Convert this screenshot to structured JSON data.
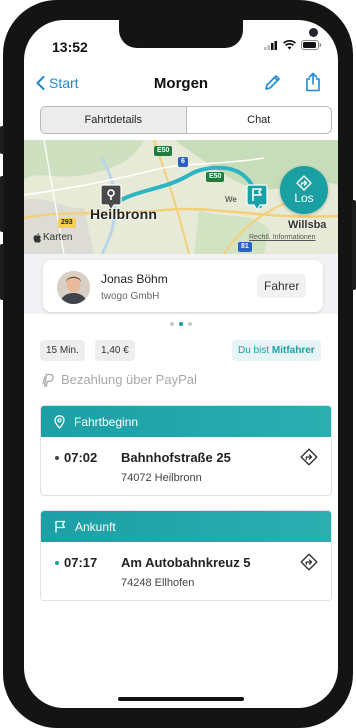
{
  "status_bar": {
    "time": "13:52"
  },
  "nav": {
    "back_label": "Start",
    "title": "Morgen"
  },
  "segments": {
    "details": "Fahrtdetails",
    "chat": "Chat"
  },
  "map": {
    "city": "Heilbronn",
    "town": "Willsba",
    "village": "We",
    "brand": "Karten",
    "legal": "Rechtl. Informationen",
    "shields": [
      "E50",
      "6",
      "E50",
      "293",
      "81"
    ],
    "go_button_label": "Los"
  },
  "driver": {
    "name": "Jonas Böhm",
    "company": "twogo GmbH",
    "role": "Fahrer"
  },
  "pager": {
    "count": 3,
    "active": 1
  },
  "chips": {
    "duration": "15 Min.",
    "price": "1,40 €",
    "role_prefix": "Du bist",
    "role_value": "Mitfahrer"
  },
  "payment": {
    "label": "Bezahlung über PayPal"
  },
  "start": {
    "heading": "Fahrtbeginn",
    "time": "07:02",
    "street": "Bahnhofstraße 25",
    "city": "74072 Heilbronn"
  },
  "arrival": {
    "heading": "Ankunft",
    "time": "07:17",
    "street": "Am Autobahnkreuz 5",
    "city": "74248 Ellhofen"
  },
  "colors": {
    "accent": "#1a9fa2",
    "link": "#1f89cf",
    "route": "#26a3b5"
  },
  "icons": [
    "signal-icon",
    "wifi-icon",
    "battery-icon",
    "chevron-left-icon",
    "pencil-icon",
    "share-icon",
    "pin-icon",
    "flag-icon",
    "directions-icon",
    "paypal-icon",
    "apple-icon"
  ]
}
